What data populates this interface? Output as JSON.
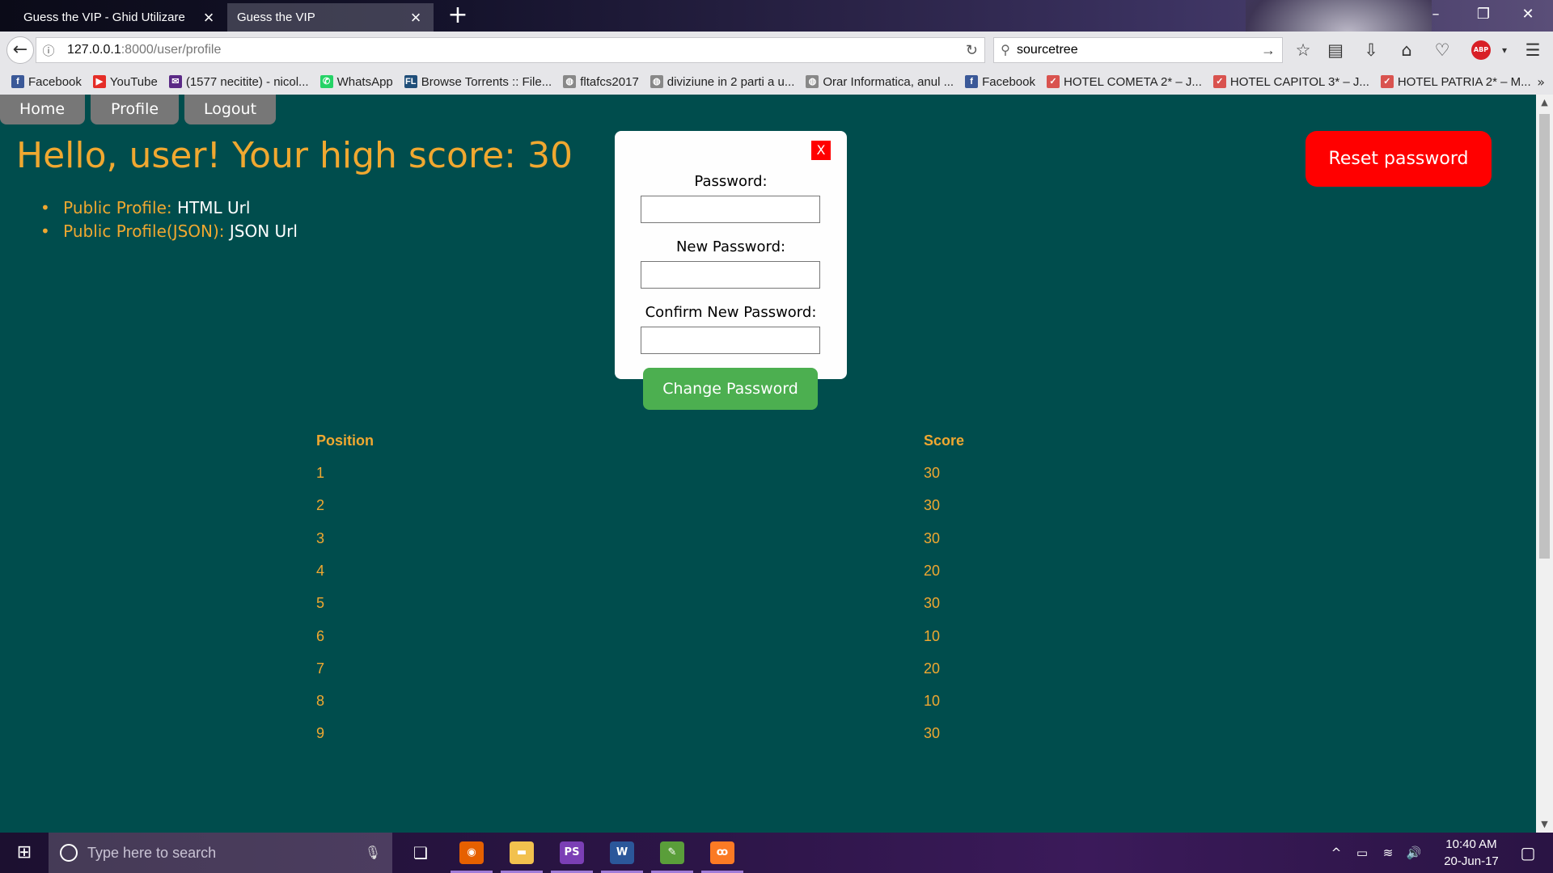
{
  "browser": {
    "tabs": [
      {
        "label": "Guess the VIP - Ghid Utilizare",
        "active": false
      },
      {
        "label": "Guess the VIP",
        "active": true
      }
    ],
    "new_tab_icon": "+",
    "url_host": "127.0.0.1",
    "url_path": ":8000/user/profile",
    "search_value": "sourcetree",
    "abp_label": "ABP",
    "bookmarks": [
      {
        "label": "Facebook",
        "icon": "facebook-icon",
        "color": "#3b5998",
        "glyph": "f"
      },
      {
        "label": "YouTube",
        "icon": "youtube-icon",
        "color": "#e52d27",
        "glyph": "▶"
      },
      {
        "label": "(1577 necitite) - nicol...",
        "icon": "mail-icon",
        "color": "#5b2a86",
        "glyph": "✉"
      },
      {
        "label": "WhatsApp",
        "icon": "whatsapp-icon",
        "color": "#25d366",
        "glyph": "✆"
      },
      {
        "label": "Browse Torrents :: File...",
        "icon": "filelist-icon",
        "color": "#1f4e79",
        "glyph": "FL"
      },
      {
        "label": "fltafcs2017",
        "icon": "globe-icon",
        "color": "#888888",
        "glyph": "◍"
      },
      {
        "label": "diviziune in 2 parti a u...",
        "icon": "globe-icon",
        "color": "#888888",
        "glyph": "◍"
      },
      {
        "label": "Orar Informatica, anul ...",
        "icon": "globe-icon",
        "color": "#888888",
        "glyph": "◍"
      },
      {
        "label": "Facebook",
        "icon": "facebook-icon",
        "color": "#3b5998",
        "glyph": "f"
      },
      {
        "label": "HOTEL COMETA 2* – J...",
        "icon": "hotel-icon",
        "color": "#d9534f",
        "glyph": "✓"
      },
      {
        "label": "HOTEL CAPITOL 3* – J...",
        "icon": "hotel-icon",
        "color": "#d9534f",
        "glyph": "✓"
      },
      {
        "label": "HOTEL PATRIA 2* – M...",
        "icon": "hotel-icon",
        "color": "#d9534f",
        "glyph": "✓"
      }
    ]
  },
  "page": {
    "nav": {
      "home": "Home",
      "profile": "Profile",
      "logout": "Logout"
    },
    "greeting": "Hello, user! Your high score: 30",
    "links": [
      {
        "label": "Public Profile:",
        "url_text": "HTML Url"
      },
      {
        "label": "Public Profile(JSON):",
        "url_text": "JSON Url"
      }
    ],
    "reset_password": "Reset password",
    "modal": {
      "close": "X",
      "password_label": "Password:",
      "new_password_label": "New Password:",
      "confirm_label": "Confirm New Password:",
      "submit": "Change Password"
    },
    "table": {
      "headers": {
        "position": "Position",
        "score": "Score"
      },
      "rows": [
        {
          "position": "1",
          "score": "30"
        },
        {
          "position": "2",
          "score": "30"
        },
        {
          "position": "3",
          "score": "30"
        },
        {
          "position": "4",
          "score": "20"
        },
        {
          "position": "5",
          "score": "30"
        },
        {
          "position": "6",
          "score": "10"
        },
        {
          "position": "7",
          "score": "20"
        },
        {
          "position": "8",
          "score": "10"
        },
        {
          "position": "9",
          "score": "30"
        }
      ]
    }
  },
  "taskbar": {
    "search_placeholder": "Type here to search",
    "apps": [
      {
        "name": "firefox-icon",
        "glyph": "◉",
        "color": "#e66000",
        "running": true
      },
      {
        "name": "file-explorer-icon",
        "glyph": "▬",
        "color": "#f2c14e",
        "running": true
      },
      {
        "name": "phpstorm-icon",
        "glyph": "PS",
        "color": "#7b3fb5",
        "running": true
      },
      {
        "name": "word-icon",
        "glyph": "W",
        "color": "#2b579a",
        "running": true
      },
      {
        "name": "photos-icon",
        "glyph": "✎",
        "color": "#5a9e3a",
        "running": true
      },
      {
        "name": "xampp-icon",
        "glyph": "ꝏ",
        "color": "#fb7a24",
        "running": true
      }
    ],
    "time": "10:40 AM",
    "date": "20-Jun-17"
  },
  "colors": {
    "page_bg": "#004d4d",
    "accent_orange": "#f0a830",
    "reset_red": "#ff0000",
    "submit_green": "#4caf50"
  }
}
